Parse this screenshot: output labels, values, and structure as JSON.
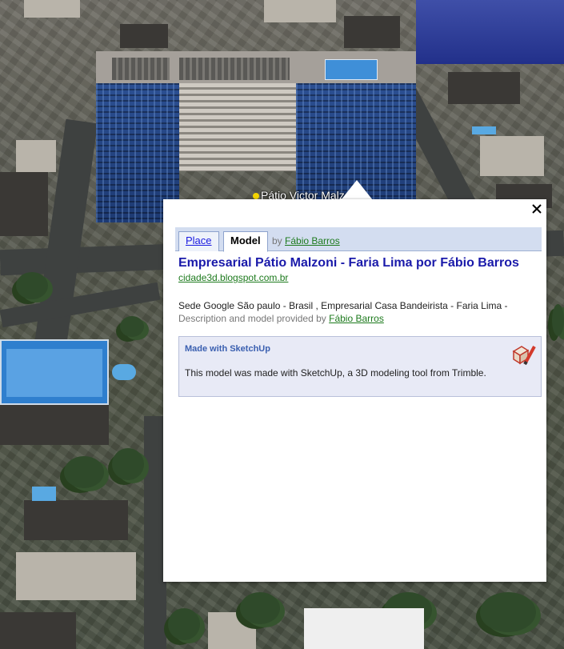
{
  "map": {
    "place_label": "Pátio Victor Malzoni"
  },
  "balloon": {
    "tabs": {
      "place_label": "Place",
      "model_label": "Model",
      "by_prefix": "by",
      "author": "Fábio Barros"
    },
    "title": "Empresarial Pátio Malzoni - Faria Lima por Fábio Barros",
    "url": "cidade3d.blogspot.com.br",
    "description": "Sede Google São paulo - Brasil , Empresarial Casa Bandeirista - Faria Lima -",
    "credit_prefix": "Description and model provided by",
    "credit_author": "Fábio Barros",
    "sketchup": {
      "heading": "Made with SketchUp",
      "text": "This model was made with SketchUp, a 3D modeling tool from Trimble."
    }
  },
  "icons": {
    "close": "close-icon",
    "sketchup": "sketchup-logo-icon"
  },
  "colors": {
    "title_link": "#1a1aaa",
    "green_link": "#1d7a1d",
    "tab_bar": "#d3ddf0",
    "sketch_box": "#e8eaf6"
  }
}
